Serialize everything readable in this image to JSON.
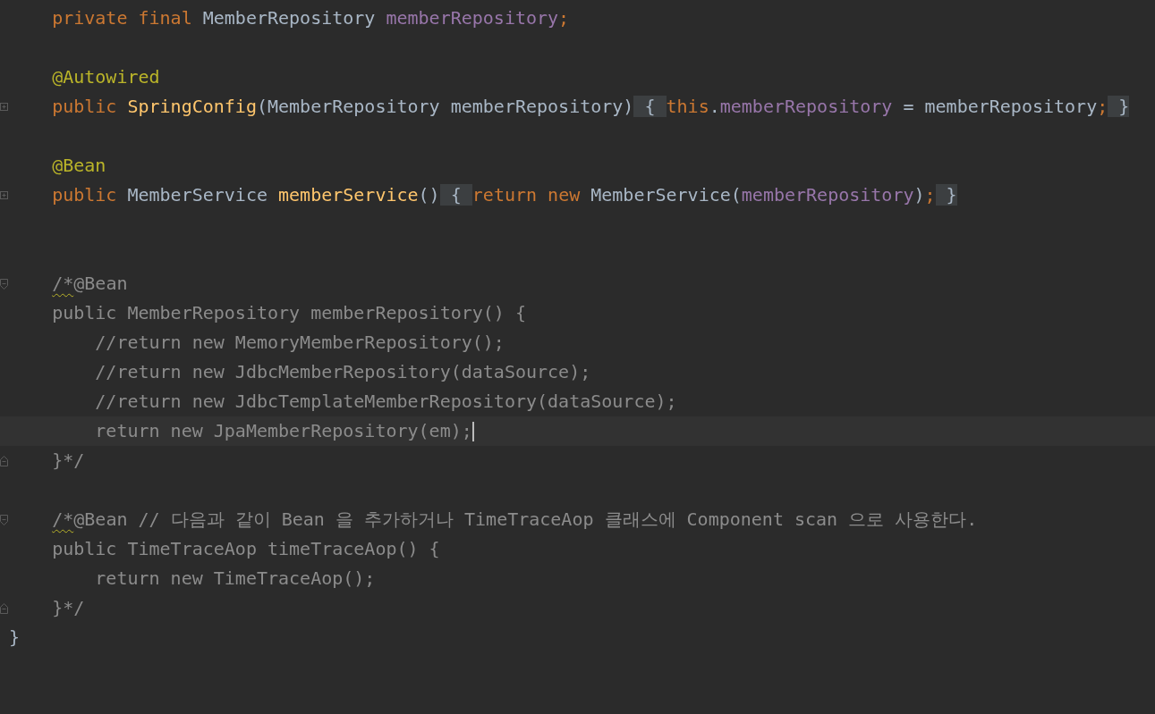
{
  "editor": {
    "lines": [
      {
        "kind": "plain",
        "tokens": [
          {
            "kind": "keyword",
            "text": "    private final "
          },
          {
            "kind": "type",
            "text": "MemberRepository "
          },
          {
            "kind": "field",
            "text": "memberRepository"
          },
          {
            "kind": "keyword",
            "text": ";"
          }
        ]
      },
      {
        "kind": "blank"
      },
      {
        "kind": "plain",
        "tokens": [
          {
            "kind": "annotation",
            "text": "    @Autowired"
          }
        ]
      },
      {
        "kind": "collapsed",
        "tokens": [
          {
            "kind": "keyword",
            "text": "    public "
          },
          {
            "kind": "method",
            "text": "SpringConfig"
          },
          {
            "kind": "type",
            "text": "(MemberRepository memberRepository)"
          },
          {
            "kind": "folded",
            "text": " { "
          },
          {
            "kind": "keyword",
            "text": "this"
          },
          {
            "kind": "type",
            "text": "."
          },
          {
            "kind": "field",
            "text": "memberRepository"
          },
          {
            "kind": "type",
            "text": " = memberRepository"
          },
          {
            "kind": "keyword",
            "text": ";"
          },
          {
            "kind": "folded",
            "text": " }"
          }
        ]
      },
      {
        "kind": "blank"
      },
      {
        "kind": "plain",
        "tokens": [
          {
            "kind": "annotation",
            "text": "    @Bean"
          }
        ]
      },
      {
        "kind": "collapsed",
        "tokens": [
          {
            "kind": "keyword",
            "text": "    public "
          },
          {
            "kind": "type",
            "text": "MemberService "
          },
          {
            "kind": "method",
            "text": "memberService"
          },
          {
            "kind": "type",
            "text": "()"
          },
          {
            "kind": "folded",
            "text": " { "
          },
          {
            "kind": "keyword",
            "text": "return new "
          },
          {
            "kind": "type",
            "text": "MemberService("
          },
          {
            "kind": "field",
            "text": "memberRepository"
          },
          {
            "kind": "type",
            "text": ")"
          },
          {
            "kind": "keyword",
            "text": ";"
          },
          {
            "kind": "folded",
            "text": " }"
          }
        ]
      },
      {
        "kind": "blank"
      },
      {
        "kind": "blank"
      },
      {
        "kind": "fold_start",
        "tokens": [
          {
            "kind": "squiggle",
            "text": "    /*"
          },
          {
            "kind": "comment",
            "text": "@Bean"
          }
        ]
      },
      {
        "kind": "plain",
        "tokens": [
          {
            "kind": "comment",
            "text": "    public MemberRepository memberRepository() {"
          }
        ]
      },
      {
        "kind": "plain",
        "tokens": [
          {
            "kind": "comment",
            "text": "        //return new MemoryMemberRepository();"
          }
        ]
      },
      {
        "kind": "plain",
        "tokens": [
          {
            "kind": "comment",
            "text": "        //return new JdbcMemberRepository(dataSource);"
          }
        ]
      },
      {
        "kind": "plain",
        "tokens": [
          {
            "kind": "comment",
            "text": "        //return new JdbcTemplateMemberRepository(dataSource);"
          }
        ]
      },
      {
        "kind": "plain",
        "current": true,
        "tokens": [
          {
            "kind": "comment",
            "text": "        return new JpaMemberRepository(em);"
          }
        ]
      },
      {
        "kind": "fold_end",
        "tokens": [
          {
            "kind": "comment",
            "text": "    }*/"
          }
        ]
      },
      {
        "kind": "blank"
      },
      {
        "kind": "fold_start",
        "tokens": [
          {
            "kind": "squiggle",
            "text": "    /*"
          },
          {
            "kind": "comment",
            "text": "@Bean // 다음과 같이 Bean 을 추가하거나 TimeTraceAop 클래스에 Component scan 으로 사용한다."
          }
        ]
      },
      {
        "kind": "plain",
        "tokens": [
          {
            "kind": "comment",
            "text": "    public TimeTraceAop timeTraceAop() {"
          }
        ]
      },
      {
        "kind": "plain",
        "tokens": [
          {
            "kind": "comment",
            "text": "        return new TimeTraceAop();"
          }
        ]
      },
      {
        "kind": "fold_end",
        "tokens": [
          {
            "kind": "comment",
            "text": "    }*/"
          }
        ]
      },
      {
        "kind": "plain",
        "tokens": [
          {
            "kind": "type",
            "text": "}"
          }
        ]
      }
    ]
  }
}
